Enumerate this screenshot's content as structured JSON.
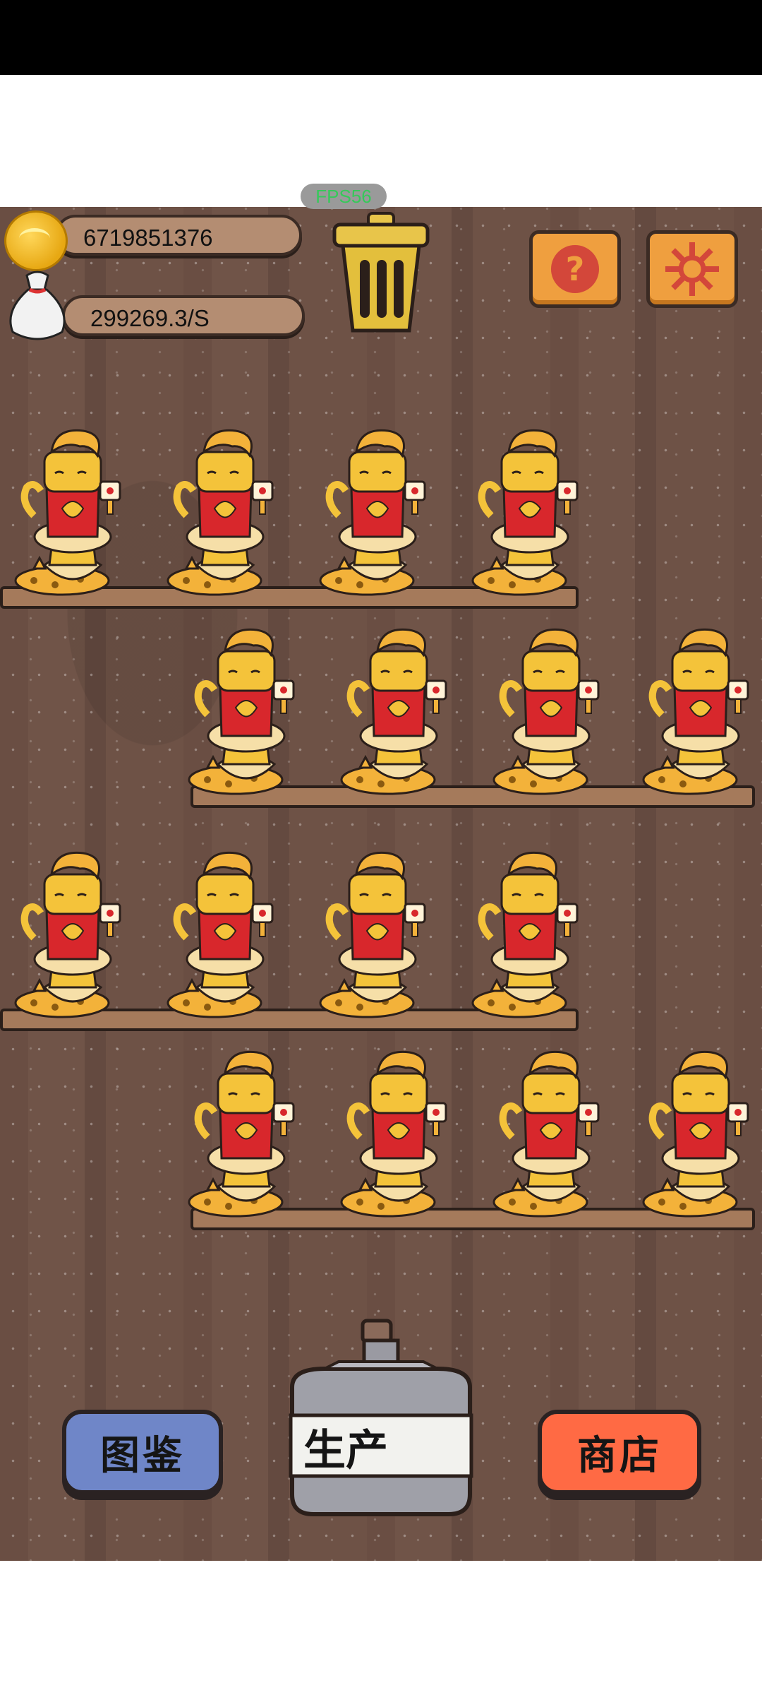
{
  "hud": {
    "fps": "FPS56",
    "coins": "6719851376",
    "rate": "299269.3/S"
  },
  "icons": {
    "coin": "coin-icon",
    "bag": "money-bag-icon",
    "trash": "trash-can-icon",
    "help": "question-mark-icon",
    "settings": "gear-icon",
    "bottle": "bottle-icon"
  },
  "buttons": {
    "collection": "图鉴",
    "produce": "生产",
    "shop": "商店"
  },
  "colors": {
    "collection": "#6f86c8",
    "shop": "#ff6a44",
    "orange": "#ef9f3f",
    "cat_body": "#f4c33a",
    "cat_robe": "#d8272c"
  },
  "cats": {
    "count": 16,
    "type": "cat-figurine"
  }
}
